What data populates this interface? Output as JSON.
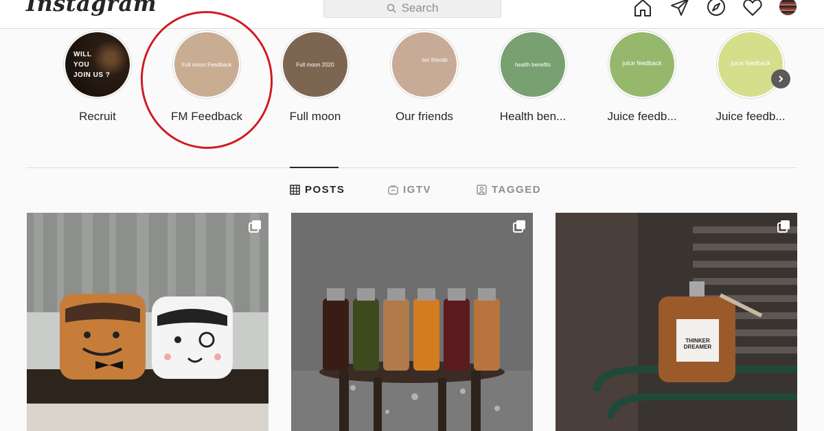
{
  "header": {
    "logo_text": "Instagram",
    "search_placeholder": "Search",
    "nav_icons": [
      "home-icon",
      "direct-icon",
      "explore-icon",
      "activity-icon",
      "profile-avatar"
    ]
  },
  "highlights": {
    "items": [
      {
        "label": "Recruit",
        "cover_text": "WILL\nYOU\nJOIN US ?",
        "cover_color": "#1e140d"
      },
      {
        "label": "FM Feedback",
        "cover_text": "Full moon Feedback",
        "cover_color": "#c9ad93"
      },
      {
        "label": "Full moon",
        "cover_text": "Full moon 2020",
        "cover_color": "#7d6651"
      },
      {
        "label": "Our friends",
        "cover_text": "our friends",
        "cover_color": "#c8ab96"
      },
      {
        "label": "Health ben...",
        "cover_text": "health benefits",
        "cover_color": "#78a071"
      },
      {
        "label": "Juice feedb...",
        "cover_text": "juice feedback",
        "cover_color": "#95b86d"
      },
      {
        "label": "Juice feedb...",
        "cover_text": "juice feedback",
        "cover_color": "#d5de8b"
      }
    ],
    "annotation_color": "#d11a21"
  },
  "tabs": [
    {
      "label": "POSTS",
      "active": true,
      "icon": "grid-icon"
    },
    {
      "label": "IGTV",
      "active": false,
      "icon": "igtv-icon"
    },
    {
      "label": "TAGGED",
      "active": false,
      "icon": "tagged-icon"
    }
  ],
  "posts": [
    {
      "content": "two plush cube toys on a bench",
      "multi_image": true
    },
    {
      "content": "row of colored juice bottles on a wet stool",
      "multi_image": true
    },
    {
      "content": "juice bottle on a green rail",
      "label_text": "THINKER DREAMER",
      "multi_image": true
    }
  ]
}
